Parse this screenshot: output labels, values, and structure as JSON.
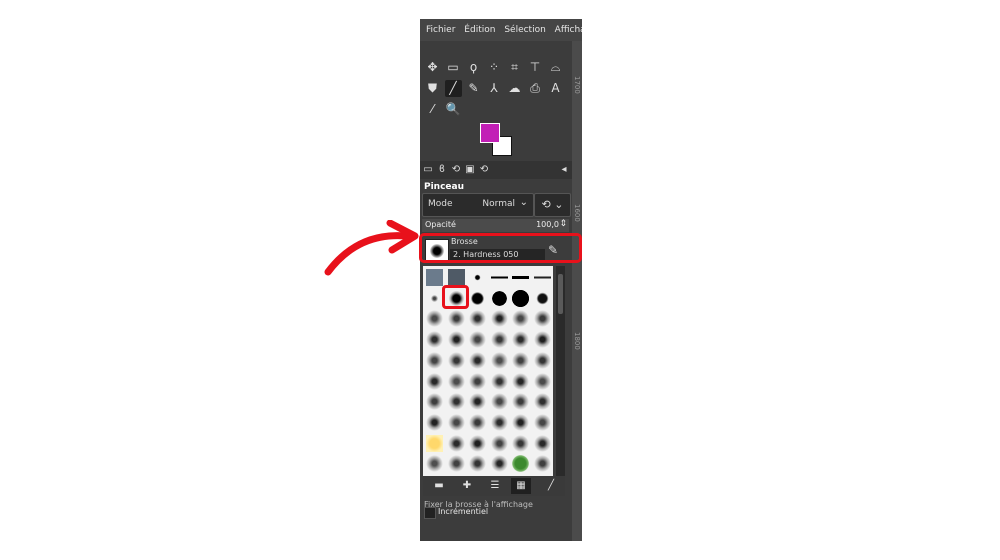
{
  "menu": [
    "Fichier",
    "Édition",
    "Sélection",
    "Afficha"
  ],
  "ruler_labels": [
    "1700",
    "1600",
    "1800"
  ],
  "toolbox": {
    "rows": [
      [
        "move-icon",
        "rect-select-icon",
        "free-select-icon",
        "fuzzy-select-icon",
        "crop-icon",
        "transform-icon",
        "warp-icon"
      ],
      [
        "bucket-fill-icon",
        "paintbrush-icon",
        "eraser-icon",
        "clone-icon",
        "smudge-icon",
        "dodge-icon",
        "text-icon"
      ],
      [
        "color-picker-icon",
        "zoom-icon"
      ]
    ],
    "glyphs": [
      [
        "✥",
        "▭",
        "ϙ",
        "⁘",
        "⌗",
        "⊤",
        "⌓"
      ],
      [
        "⛊",
        "╱",
        "✎",
        "⅄",
        "☁",
        "⎙",
        "A"
      ],
      [
        "⁄",
        "🔍"
      ]
    ],
    "active_tool": "paintbrush-icon",
    "foreground_color": "#c21fb6",
    "background_color": "#ffffff"
  },
  "tool_options": {
    "title": "Pinceau",
    "mode_label": "Mode",
    "mode_value": "Normal",
    "opacity_label": "Opacité",
    "opacity_value": "100,0",
    "brush_label": "Brosse",
    "brush_value": "2. Hardness 050",
    "option_partial": "Fixer la brosse à l'affichage",
    "incremental_label": "Incrémentiel"
  },
  "brush_grid_bar": [
    "zoom-out-icon",
    "zoom-in-icon",
    "list-view-icon",
    "grid-view-icon",
    "brush-icon"
  ],
  "annotation_color": "#e8111b"
}
